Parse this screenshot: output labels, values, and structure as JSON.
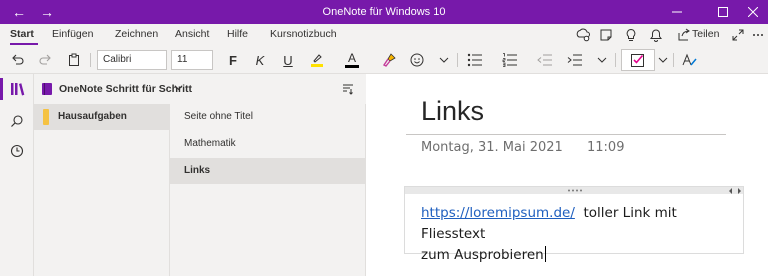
{
  "window": {
    "title": "OneNote für Windows 10",
    "back_glyph": "←",
    "forward_glyph": "→",
    "minimize_glyph": "—",
    "maximize_glyph": "☐",
    "close_glyph": "✕"
  },
  "ribbon": {
    "tabs": [
      {
        "label": "Start",
        "active": true
      },
      {
        "label": "Einfügen",
        "active": false
      },
      {
        "label": "Zeichnen",
        "active": false
      },
      {
        "label": "Ansicht",
        "active": false
      },
      {
        "label": "Hilfe",
        "active": false
      },
      {
        "label": "Kursnotizbuch",
        "active": false
      }
    ],
    "share_label": "Teilen",
    "accent": "#7719aa"
  },
  "toolbar": {
    "font_name": "Calibri",
    "font_size": "11",
    "bold_glyph": "F",
    "italic_glyph": "K",
    "underline_glyph": "U",
    "font_color_glyph": "A",
    "icons": [
      "undo-icon",
      "redo-icon",
      "clipboard-icon",
      "highlight-icon",
      "font-color-icon",
      "format-painter-icon",
      "bullets-icon",
      "numbering-icon",
      "outdent-icon",
      "indent-icon",
      "checkbox-tag-icon",
      "styles-icon"
    ]
  },
  "notebook": {
    "name": "OneNote Schritt für Schritt",
    "sections": [
      {
        "label": "Hausaufgaben",
        "color": "#f5c242"
      }
    ],
    "pages": [
      {
        "label": "Seite ohne Titel",
        "selected": false
      },
      {
        "label": "Mathematik",
        "selected": false
      },
      {
        "label": "Links",
        "selected": true
      }
    ]
  },
  "page": {
    "title": "Links",
    "date": "Montag, 31. Mai 2021",
    "time": "11:09",
    "link_text": "https://loremipsum.de/",
    "text_line1_rest": "toller Link mit Fliesstext",
    "text_line2": "zum Ausprobieren"
  }
}
